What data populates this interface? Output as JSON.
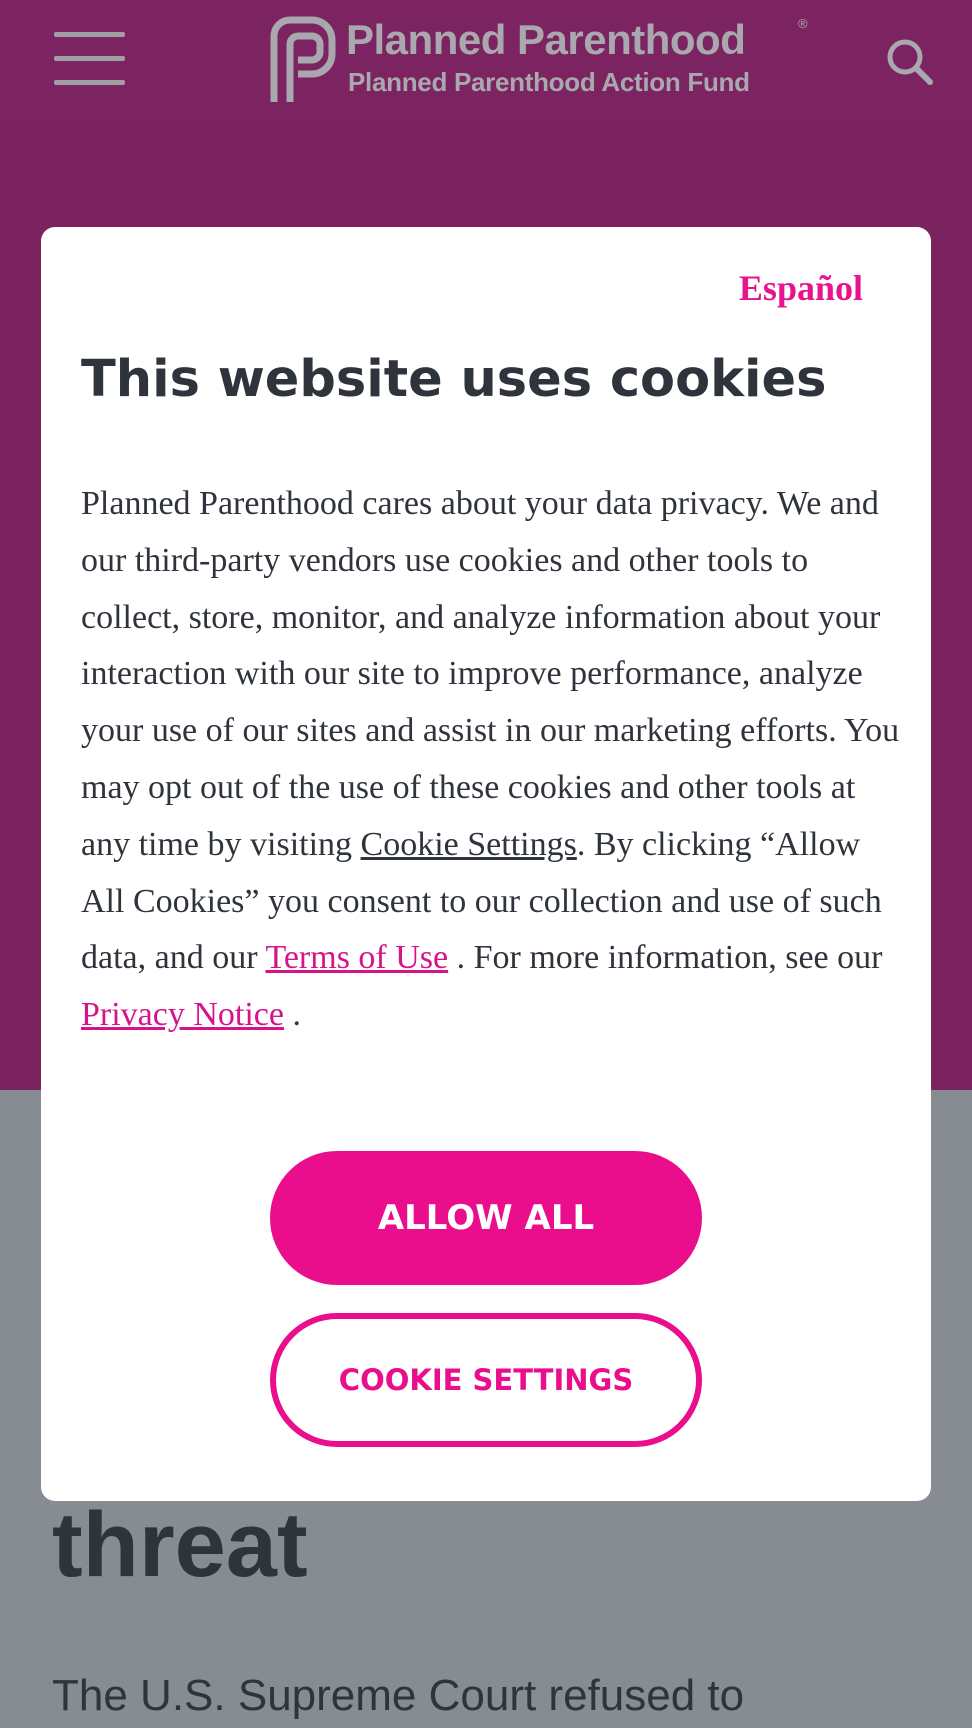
{
  "header": {
    "logo_title": "Planned Parenthood",
    "logo_registered": "®",
    "logo_subtitle": "Planned Parenthood Action Fund",
    "menu_icon": "hamburger-menu-icon",
    "search_icon": "search-icon"
  },
  "article": {
    "heading_fragment": "threat",
    "text_fragment": "The U.S. Supreme Court refused to"
  },
  "cookie_modal": {
    "language_link": "Español",
    "title": "This website uses cookies",
    "body": {
      "part1": "Planned Parenthood cares about your data privacy. We and our third-party vendors use cookies and other tools to collect, store, monitor, and analyze information about your interaction with our site to improve performance, analyze your use of our sites and assist in our marketing efforts. You may opt out of the use of these cookies and other tools at any time by visiting ",
      "cookie_settings_link": "Cookie Settings",
      "part2": ". By clicking “Allow All Cookies” you consent to our collection and use of such data, and our ",
      "terms_link": "Terms of Use",
      "part3": " . For more information, see our ",
      "privacy_link": "Privacy Notice",
      "part4": " ."
    },
    "allow_all_button": "ALLOW ALL",
    "cookie_settings_button": "COOKIE SETTINGS"
  },
  "colors": {
    "header_purple": "#7b2461",
    "overlay_gray": "#878c93",
    "accent_pink": "#ea0d8c",
    "text_dark": "#2f343c",
    "logo_gray": "#a9a8ae"
  }
}
